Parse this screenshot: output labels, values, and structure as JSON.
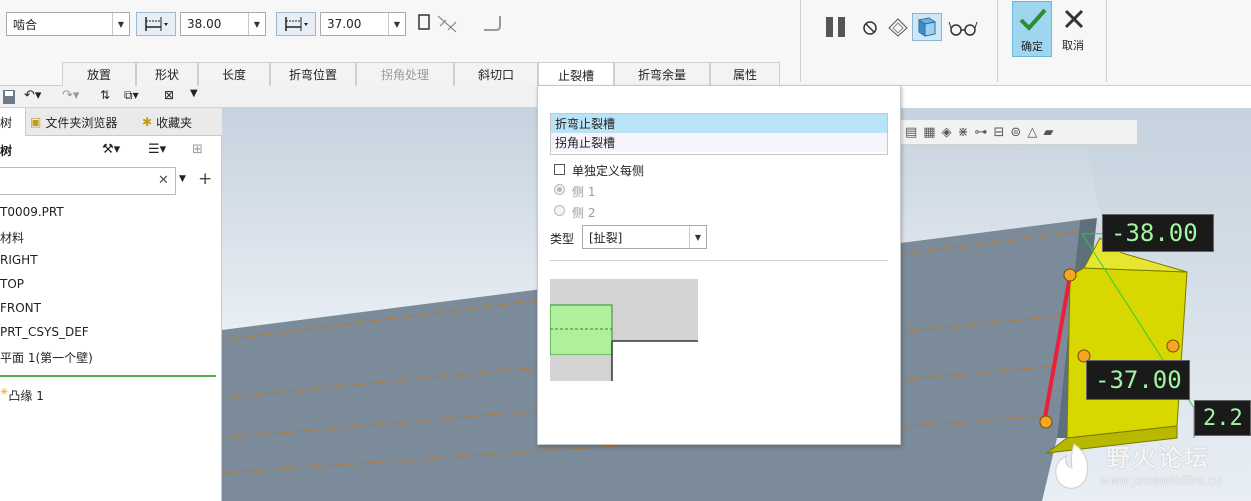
{
  "ribbon": {
    "mode_value": "啮合",
    "length1_value": "38.00",
    "length2_value": "37.00",
    "ok_label": "确定",
    "cancel_label": "取消"
  },
  "tabs": [
    {
      "label": "放置"
    },
    {
      "label": "形状"
    },
    {
      "label": "长度"
    },
    {
      "label": "折弯位置"
    },
    {
      "label": "拐角处理"
    },
    {
      "label": "斜切口"
    },
    {
      "label": "止裂槽"
    },
    {
      "label": "折弯余量"
    },
    {
      "label": "属性"
    }
  ],
  "left_panel": {
    "tab_model_tree": "型树",
    "tab_folder_browser": "文件夹浏览器",
    "tab_favorites": "收藏夹",
    "tree_header": "树",
    "search_value": "",
    "items": [
      {
        "label": "T0009.PRT"
      },
      {
        "label": "材料"
      },
      {
        "label": "RIGHT"
      },
      {
        "label": "TOP"
      },
      {
        "label": "FRONT"
      },
      {
        "label": "PRT_CSYS_DEF"
      },
      {
        "label": "平面 1(第一个壁)"
      }
    ],
    "insert_item": "凸缘 1"
  },
  "relief_panel": {
    "list_items": [
      {
        "label": "折弯止裂槽"
      },
      {
        "label": "拐角止裂槽"
      }
    ],
    "define_each_side_label": "单独定义每侧",
    "side1_label": "侧 1",
    "side2_label": "侧 2",
    "type_label": "类型",
    "type_value": "[扯裂]"
  },
  "viewport": {
    "dim_length1": "-38.00",
    "dim_length2": "-37.00",
    "dim_thickness": "2.2"
  },
  "watermark": {
    "title": "野火论坛",
    "url": "www.proewildfire.cn"
  },
  "colors": {
    "accent_blue": "#b9e3f7",
    "ok_button_bg": "#9ed6f0",
    "feature_yellow": "#d8d800",
    "highlight_red": "#e8203a",
    "handle_orange": "#f5a623",
    "dim_green": "#2ecc40",
    "model_gray": "#7a8a98"
  }
}
